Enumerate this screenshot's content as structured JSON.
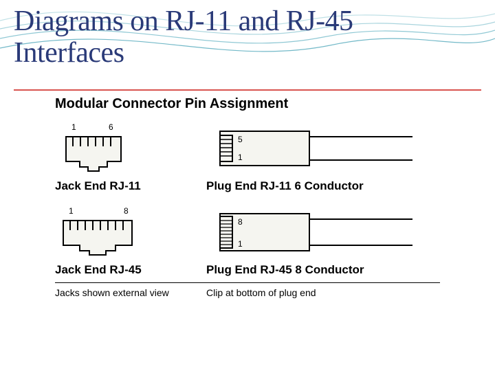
{
  "title": "Diagrams on RJ-11 and RJ-45 Interfaces",
  "section_title": "Modular Connector Pin Assignment",
  "diagrams": {
    "jack_rj11": {
      "label": "Jack End RJ-11",
      "pin_start": "1",
      "pin_end": "6",
      "positions": 6
    },
    "plug_rj11": {
      "label": "Plug End RJ-11 6 Conductor",
      "pin_top": "5",
      "pin_bottom": "1"
    },
    "jack_rj45": {
      "label": "Jack End RJ-45",
      "pin_start": "1",
      "pin_end": "8",
      "positions": 8
    },
    "plug_rj45": {
      "label": "Plug End RJ-45 8 Conductor",
      "pin_top": "8",
      "pin_bottom": "1"
    }
  },
  "notes": {
    "left": "Jacks shown external view",
    "right": "Clip at bottom of plug end"
  },
  "colors": {
    "title": "#2a3a78",
    "accent": "#d9534f"
  }
}
